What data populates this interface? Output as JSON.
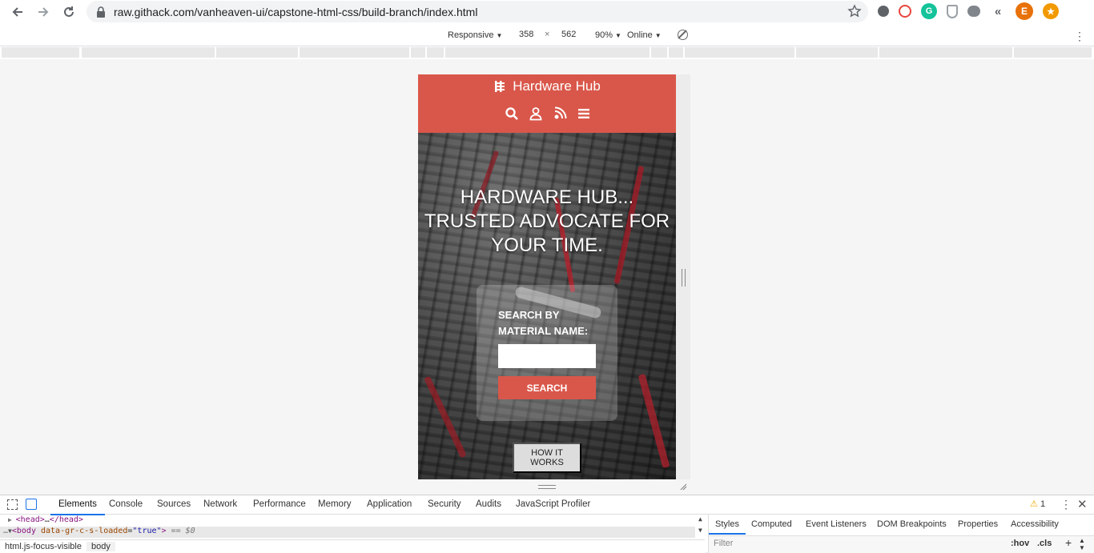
{
  "browser": {
    "url": "raw.githack.com/vanheaven-ui/capstone-html-css/build-branch/index.html",
    "avatar_letter": "E"
  },
  "device_toolbar": {
    "mode": "Responsive",
    "width": "358",
    "times": "×",
    "height": "562",
    "zoom": "90%",
    "throttle": "Online"
  },
  "site": {
    "brand": "Hardware Hub",
    "header_icons": [
      "search-icon",
      "user-icon",
      "podcast-icon",
      "menu-icon"
    ],
    "colors": {
      "accent": "#d9574a"
    },
    "hero_title": "HARDWARE HUB... TRUSTED ADVOCATE FOR YOUR TIME.",
    "search_label": "SEARCH BY MATERIAL NAME:",
    "search_button": "SEARCH",
    "how_button": "HOW IT WORKS"
  },
  "devtools": {
    "tabs": [
      "Elements",
      "Console",
      "Sources",
      "Network",
      "Performance",
      "Memory",
      "Application",
      "Security",
      "Audits",
      "JavaScript Profiler"
    ],
    "active_tab": "Elements",
    "warnings": "1",
    "dom": {
      "head_tag_open": "<head>",
      "head_ellipsis": "…",
      "head_tag_close": "</head>",
      "body_open": "<body",
      "body_attr": "data-gr-c-s-loaded",
      "body_eq": "=",
      "body_val": "\"true\"",
      "body_close": ">",
      "body_suffix": "== $0"
    },
    "breadcrumbs": [
      "html.js-focus-visible",
      "body"
    ],
    "styles_tabs": [
      "Styles",
      "Computed",
      "Event Listeners",
      "DOM Breakpoints",
      "Properties",
      "Accessibility"
    ],
    "filter_placeholder": "Filter",
    "hov": ":hov",
    "cls": ".cls",
    "plus": "+"
  }
}
